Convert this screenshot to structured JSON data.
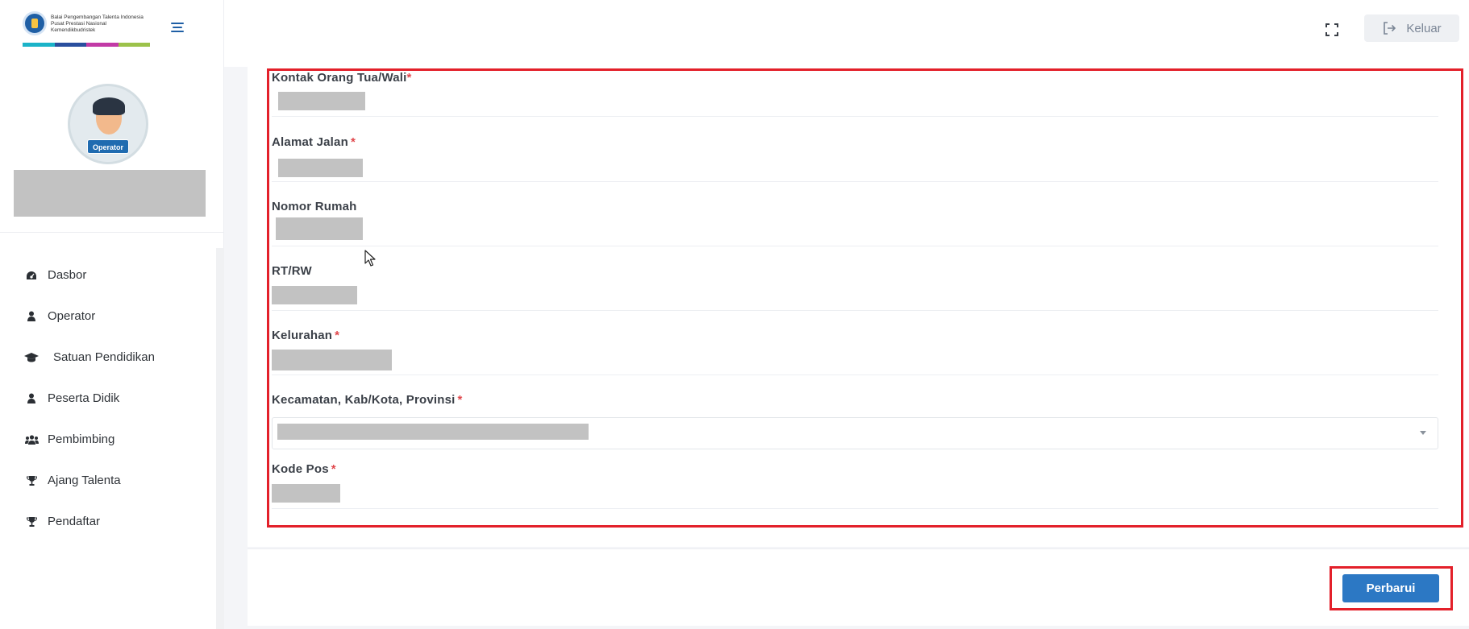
{
  "logo": {
    "text": "Balai Pengembangan Talenta Indonesia Pusat Prestasi Nasional Kemendikbudristek",
    "bar_colors": [
      "#1bb3c8",
      "#2a4f9e",
      "#c23aa6",
      "#9cc24a"
    ]
  },
  "profile": {
    "role_badge": "Operator"
  },
  "sidebar": {
    "items": [
      {
        "label": "Dasbor",
        "icon": "dashboard-icon"
      },
      {
        "label": "Operator",
        "icon": "user-icon"
      },
      {
        "label": "Satuan Pendidikan",
        "icon": "graduation-cap-icon"
      },
      {
        "label": "Peserta Didik",
        "icon": "user-icon"
      },
      {
        "label": "Pembimbing",
        "icon": "users-icon"
      },
      {
        "label": "Ajang Talenta",
        "icon": "trophy-icon"
      },
      {
        "label": "Pendaftar",
        "icon": "trophy-icon"
      }
    ]
  },
  "header": {
    "logout_label": "Keluar"
  },
  "form": {
    "fields": [
      {
        "label": "Kontak Orang Tua/Wali",
        "required": true
      },
      {
        "label": "Alamat Jalan",
        "required": true
      },
      {
        "label": "Nomor Rumah",
        "required": false
      },
      {
        "label": "RT/RW",
        "required": false
      },
      {
        "label": "Kelurahan",
        "required": true
      },
      {
        "label": "Kecamatan, Kab/Kota, Provinsi",
        "required": true
      },
      {
        "label": "Kode Pos",
        "required": true
      }
    ],
    "required_mark": "*",
    "submit_label": "Perbarui"
  },
  "colors": {
    "accent": "#2c78c4",
    "highlight": "#e3202a",
    "required": "#e0474c",
    "redaction": "#c2c2c2"
  }
}
